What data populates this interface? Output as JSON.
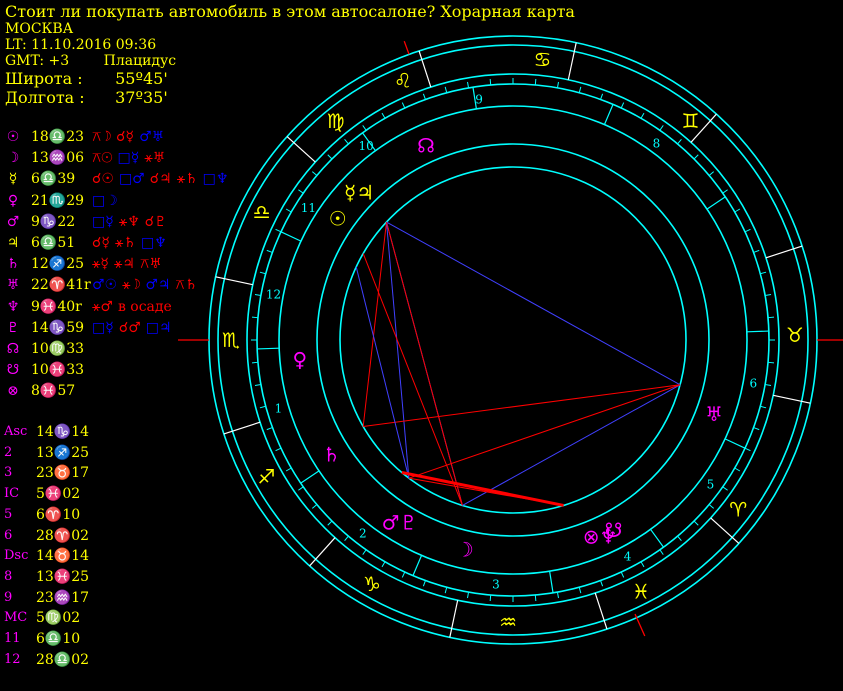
{
  "header": {
    "title": "Стоит ли покупать автомобиль в этом автосалоне? Хорарная карта",
    "city": "МОСКВА",
    "lt": "LT: 11.10.2016  09:36",
    "gmt": "GMT: +3",
    "system": "Плацидус",
    "lat_label": "Широта :",
    "lat_value": "55º45'",
    "lon_label": "Долгота :",
    "lon_value": "37º35'"
  },
  "planets": [
    {
      "glyph": "☉",
      "color": "#ff00ff",
      "pos": "18♎23",
      "aspects": [
        {
          "t": "⚻☽",
          "c": "#ff0000"
        },
        {
          "t": "☌☿",
          "c": "#ff0000"
        },
        {
          "t": "♂♅",
          "c": "#0000ff"
        }
      ]
    },
    {
      "glyph": "☽",
      "color": "#ff00ff",
      "pos": "13♒06",
      "aspects": [
        {
          "t": "⚻☉",
          "c": "#ff0000"
        },
        {
          "t": "□☿",
          "c": "#0000ff"
        },
        {
          "t": "⚹♅",
          "c": "#ff0000"
        }
      ]
    },
    {
      "glyph": "☿",
      "color": "#ffff00",
      "pos": "6♎39",
      "aspects": [
        {
          "t": "☌☉",
          "c": "#ff0000"
        },
        {
          "t": "□♂",
          "c": "#0000ff"
        },
        {
          "t": "☌♃",
          "c": "#ff0000"
        },
        {
          "t": "⚹♄",
          "c": "#ff0000"
        },
        {
          "t": "□♆",
          "c": "#0000ff"
        }
      ]
    },
    {
      "glyph": "♀",
      "color": "#ff00ff",
      "pos": "21♏29",
      "aspects": [
        {
          "t": "□☽",
          "c": "#0000ff"
        }
      ]
    },
    {
      "glyph": "♂",
      "color": "#ff00ff",
      "pos": "9♑22",
      "aspects": [
        {
          "t": "□☿",
          "c": "#0000ff"
        },
        {
          "t": "⚹♆",
          "c": "#ff0000"
        },
        {
          "t": "☌♇",
          "c": "#ff0000"
        }
      ]
    },
    {
      "glyph": "♃",
      "color": "#ffff00",
      "pos": "6♎51",
      "aspects": [
        {
          "t": "☌☿",
          "c": "#ff0000"
        },
        {
          "t": "⚹♄",
          "c": "#ff0000"
        },
        {
          "t": "□♆",
          "c": "#0000ff"
        }
      ]
    },
    {
      "glyph": "♄",
      "color": "#ff00ff",
      "pos": "12♐25",
      "aspects": [
        {
          "t": "⚹☿",
          "c": "#ff0000"
        },
        {
          "t": "⚹♃",
          "c": "#ff0000"
        },
        {
          "t": "⚻♅",
          "c": "#ff0000"
        }
      ]
    },
    {
      "glyph": "♅",
      "color": "#ff00ff",
      "pos": "22♈41r",
      "aspects": [
        {
          "t": "♂☉",
          "c": "#0000ff"
        },
        {
          "t": "⚹☽",
          "c": "#ff0000"
        },
        {
          "t": "♂♃",
          "c": "#0000ff"
        },
        {
          "t": "⚻♄",
          "c": "#ff0000"
        }
      ]
    },
    {
      "glyph": "♆",
      "color": "#ff00ff",
      "pos": "9♓40r",
      "aspects": [
        {
          "t": "⚹♂",
          "c": "#ff0000"
        },
        {
          "t": "в осаде",
          "c": "#ff0000"
        }
      ]
    },
    {
      "glyph": "♇",
      "color": "#ff00ff",
      "pos": "14♑59",
      "aspects": [
        {
          "t": "□☿",
          "c": "#0000ff"
        },
        {
          "t": "☌♂",
          "c": "#ff0000"
        },
        {
          "t": "□♃",
          "c": "#0000ff"
        }
      ]
    },
    {
      "glyph": "☊",
      "color": "#ff00ff",
      "pos": "10♍33",
      "aspects": []
    },
    {
      "glyph": "☋",
      "color": "#ff00ff",
      "pos": "10♓33",
      "aspects": []
    },
    {
      "glyph": "⊗",
      "color": "#ff00ff",
      "pos": "8♓57",
      "aspects": []
    }
  ],
  "houses": [
    {
      "label": "Asc",
      "val": "14♑14"
    },
    {
      "label": "2",
      "val": "13♐25"
    },
    {
      "label": "3",
      "val": "23♉17"
    },
    {
      "label": "IC",
      "val": "5♓02"
    },
    {
      "label": "5",
      "val": "6♈10"
    },
    {
      "label": "6",
      "val": "28♈02"
    },
    {
      "label": "Dsc",
      "val": "14♉14"
    },
    {
      "label": "8",
      "val": "13♓25"
    },
    {
      "label": "9",
      "val": "23♒17"
    },
    {
      "label": "MC",
      "val": "5♍02"
    },
    {
      "label": "11",
      "val": "6♎10"
    },
    {
      "label": "12",
      "val": "28♎02"
    }
  ],
  "wheel": {
    "signs": [
      {
        "glyph": "♌",
        "angle": 113
      },
      {
        "glyph": "♋",
        "angle": 84
      },
      {
        "glyph": "♊",
        "angle": 51
      },
      {
        "glyph": "♉",
        "angle": 1
      },
      {
        "glyph": "♈",
        "angle": -37
      },
      {
        "glyph": "♓",
        "angle": -63
      },
      {
        "glyph": "♒",
        "angle": -91
      },
      {
        "glyph": "♑",
        "angle": -120
      },
      {
        "glyph": "♐",
        "angle": -151
      },
      {
        "glyph": "♏",
        "angle": 180
      },
      {
        "glyph": "♎",
        "angle": 153
      },
      {
        "glyph": "♍",
        "angle": 129
      }
    ],
    "house_numbers": [
      {
        "n": "9",
        "angle": 98
      },
      {
        "n": "8",
        "angle": 54
      },
      {
        "n": "6",
        "angle": -10
      },
      {
        "n": "5",
        "angle": -36
      },
      {
        "n": "4",
        "angle": -62
      },
      {
        "n": "3",
        "angle": -94
      },
      {
        "n": "2",
        "angle": -128
      },
      {
        "n": "1",
        "angle": -164
      },
      {
        "n": "12",
        "angle": 169
      },
      {
        "n": "11",
        "angle": 147
      },
      {
        "n": "10",
        "angle": 127
      }
    ],
    "planet_marks": [
      {
        "glyph": "☊",
        "color": "#ff00ff",
        "angle": 114,
        "label": "node"
      },
      {
        "glyph": "☿♃",
        "color": "#ffff00",
        "angle": 136,
        "label": "mercury-jupiter"
      },
      {
        "glyph": "☉",
        "color": "#ffff00",
        "angle": 145,
        "label": "sun"
      },
      {
        "glyph": "♀",
        "color": "#ff00ff",
        "angle": -175,
        "label": "venus"
      },
      {
        "glyph": "♄",
        "color": "#ff00ff",
        "angle": -148,
        "label": "saturn"
      },
      {
        "glyph": "♂♇",
        "color": "#ff00ff",
        "angle": -122,
        "label": "mars-pluto"
      },
      {
        "glyph": "☽",
        "color": "#ff00ff",
        "angle": -103,
        "label": "moon"
      },
      {
        "glyph": "☋",
        "color": "#ff00ff",
        "angle": -62,
        "label": "south-node"
      },
      {
        "glyph": "⊗♆",
        "color": "#ff00ff",
        "angle": -66,
        "label": "fortune-neptune"
      },
      {
        "glyph": "♅",
        "color": "#ff00ff",
        "angle": -20,
        "label": "uranus"
      }
    ]
  },
  "colors": {
    "wheel": "#00ffff",
    "axis": "#ff0000",
    "aspect_blue": "#4040ff",
    "aspect_red": "#ff0000",
    "text": "#ffff00",
    "accent": "#ff00ff"
  }
}
